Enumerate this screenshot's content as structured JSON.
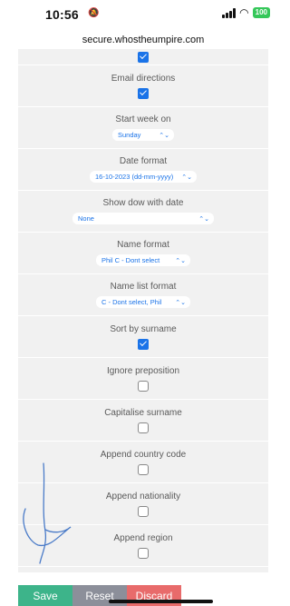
{
  "status": {
    "time": "10:56",
    "battery": "100"
  },
  "browser": {
    "url": "secure.whostheumpire.com"
  },
  "settings": [
    {
      "type": "checkbox",
      "label": "",
      "checked": true
    },
    {
      "type": "checkbox",
      "label": "Email directions",
      "checked": true
    },
    {
      "type": "select",
      "label": "Start week on",
      "value": "Sunday"
    },
    {
      "type": "select",
      "label": "Date format",
      "value": "16-10-2023 (dd-mm-yyyy)"
    },
    {
      "type": "select",
      "label": "Show dow with date",
      "value": "None"
    },
    {
      "type": "select",
      "label": "Name format",
      "value": "Phil C - Dont select"
    },
    {
      "type": "select",
      "label": "Name list format",
      "value": "C - Dont select, Phil"
    },
    {
      "type": "checkbox",
      "label": "Sort by surname",
      "checked": true
    },
    {
      "type": "checkbox",
      "label": "Ignore preposition",
      "checked": false
    },
    {
      "type": "checkbox",
      "label": "Capitalise surname",
      "checked": false
    },
    {
      "type": "checkbox",
      "label": "Append country code",
      "checked": false
    },
    {
      "type": "checkbox",
      "label": "Append nationality",
      "checked": false
    },
    {
      "type": "checkbox",
      "label": "Append region",
      "checked": false
    }
  ],
  "actions": {
    "save": "Save",
    "reset": "Reset",
    "discard": "Discard"
  },
  "colors": {
    "accent": "#1a73e8",
    "save": "#3db48a",
    "reset": "#8c8f9a",
    "discard": "#e86b6b"
  }
}
